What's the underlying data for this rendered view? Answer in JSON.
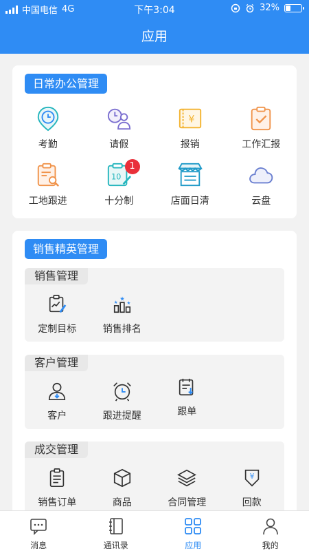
{
  "status": {
    "carrier": "中国电信",
    "network": "4G",
    "time": "下午3:04",
    "battery": "32%",
    "battery_level": 0.32
  },
  "header": {
    "title": "应用"
  },
  "daily": {
    "title": "日常办公管理",
    "items": [
      {
        "label": "考勤",
        "icon": "clock-location-icon"
      },
      {
        "label": "请假",
        "icon": "leave-person-icon"
      },
      {
        "label": "报销",
        "icon": "receipt-yen-icon"
      },
      {
        "label": "工作汇报",
        "icon": "clipboard-check-icon"
      },
      {
        "label": "工地跟进",
        "icon": "clipboard-search-icon"
      },
      {
        "label": "十分制",
        "icon": "score-edit-icon",
        "badge": "1"
      },
      {
        "label": "店面日清",
        "icon": "storefront-icon"
      },
      {
        "label": "云盘",
        "icon": "cloud-icon"
      }
    ]
  },
  "sales": {
    "title": "销售精英管理",
    "groups": [
      {
        "title": "销售管理",
        "items": [
          {
            "label": "定制目标",
            "icon": "target-chart-icon"
          },
          {
            "label": "销售排名",
            "icon": "ranking-icon"
          }
        ]
      },
      {
        "title": "客户管理",
        "items": [
          {
            "label": "客户",
            "icon": "customer-icon"
          },
          {
            "label": "跟进提醒",
            "icon": "alarm-clock-icon"
          },
          {
            "label": "跟单",
            "icon": "follow-doc-icon"
          }
        ]
      },
      {
        "title": "成交管理",
        "items": [
          {
            "label": "销售订单",
            "icon": "order-doc-icon"
          },
          {
            "label": "商品",
            "icon": "product-box-icon"
          },
          {
            "label": "合同管理",
            "icon": "layers-icon"
          },
          {
            "label": "回款",
            "icon": "payment-return-icon"
          }
        ]
      }
    ]
  },
  "tabs": [
    {
      "label": "消息",
      "icon": "message-icon"
    },
    {
      "label": "通讯录",
      "icon": "contacts-book-icon"
    },
    {
      "label": "应用",
      "icon": "apps-grid-icon",
      "active": true
    },
    {
      "label": "我的",
      "icon": "profile-icon"
    }
  ],
  "colors": {
    "primary": "#2f8cf4",
    "badge": "#e9303a",
    "orange": "#f0934a",
    "teal": "#24b5bd",
    "purple": "#7b6fd0",
    "gold": "#f3b330"
  }
}
